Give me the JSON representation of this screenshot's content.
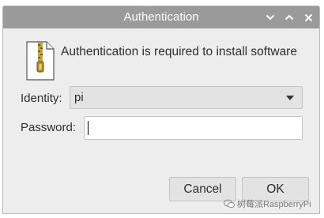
{
  "window": {
    "title": "Authentication",
    "controls": {
      "minimize_icon": "chevron-down-icon",
      "maximize_icon": "chevron-up-icon",
      "close_icon": "close-icon"
    }
  },
  "dialog": {
    "icon": "zip-archive-icon",
    "message": "Authentication is required to install software",
    "identity": {
      "label": "Identity:",
      "selected_value": "pi"
    },
    "password": {
      "label": "Password:",
      "value": ""
    }
  },
  "buttons": {
    "cancel_label": "Cancel",
    "ok_label": "OK"
  },
  "watermark": {
    "text": "树莓派RaspberryPi"
  },
  "colors": {
    "titlebar": "#9a9a9a",
    "window_background": "#ededed",
    "button_background": "#e3e3e3",
    "field_border": "#c4c4c4",
    "text": "#2e2e2e"
  }
}
